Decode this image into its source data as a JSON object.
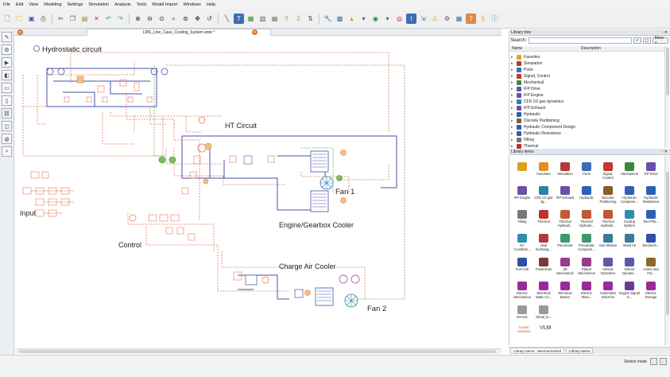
{
  "menu": [
    "File",
    "Edit",
    "View",
    "Modeling",
    "Settings",
    "Simulation",
    "Analysis",
    "Tools",
    "Model Import",
    "Windows",
    "Help"
  ],
  "document_tab": "LMS_Line_Case_Cooling_System.ame *",
  "canvas_labels": {
    "hydrostatic": "Hydrostatic circuit",
    "ht_circuit": "HT Circuit",
    "fan1": "Fan 1",
    "engine_cooler": "Engine/Gearbox Cooler",
    "input": "Input",
    "control": "Control",
    "charge_air": "Charge Air Cooler",
    "fan2": "Fan 2"
  },
  "library_tree": {
    "title": "Library tree",
    "search_label": "Search:",
    "search_value": "",
    "more_button": "More >",
    "col_name": "Name",
    "col_description": "Description",
    "items": [
      "Favorites",
      "Simulation",
      "Ports",
      "Signal, Control",
      "Mechanical",
      "IFP Drive",
      "IFP Engine",
      "CFD 1D gas dynamics",
      "IFP Exhaust",
      "Hydraulic",
      "Discrete Partitioning",
      "Hydraulic Component Design",
      "Hydraulic Resistance",
      "Filling",
      "Thermal"
    ],
    "item_colors": [
      "#e6a21c",
      "#b23b3b",
      "#3b6fb2",
      "#c0392b",
      "#3a8a3a",
      "#6b4fa8",
      "#6b4fa8",
      "#2f7fa8",
      "#6b4fa8",
      "#2f5fb2",
      "#8a5a2b",
      "#2f5fb2",
      "#2f5fb2",
      "#777777",
      "#c03030"
    ]
  },
  "library_items": {
    "title": "Library items",
    "items": [
      {
        "label": "..",
        "color": "#d9a21c"
      },
      {
        "label": "Favorites",
        "color": "#e09020"
      },
      {
        "label": "Simulation",
        "color": "#b23b3b"
      },
      {
        "label": "Ports",
        "color": "#3b6fb2"
      },
      {
        "label": "Signal, Control",
        "color": "#c0392b"
      },
      {
        "label": "Mechanical",
        "color": "#3a8a3a"
      },
      {
        "label": "IFP Drive",
        "color": "#6b4fa8"
      },
      {
        "label": "IFP Engine",
        "color": "#6b4fa8"
      },
      {
        "label": "CFD 1D gas dy...",
        "color": "#2f7fa8"
      },
      {
        "label": "IFP Exhaust",
        "color": "#6b4fa8"
      },
      {
        "label": "Hydraulic",
        "color": "#2f5fb2"
      },
      {
        "label": "Discrete Partitioning",
        "color": "#8a5a2b"
      },
      {
        "label": "Hydraulic Compone...",
        "color": "#2f5fb2"
      },
      {
        "label": "Hydraulic Resistance",
        "color": "#2f5fb2"
      },
      {
        "label": "Filling",
        "color": "#777777"
      },
      {
        "label": "Thermal",
        "color": "#c03030"
      },
      {
        "label": "Thermal Hydrauli...",
        "color": "#c05a30"
      },
      {
        "label": "Thermal Hydrauli...",
        "color": "#c05a30"
      },
      {
        "label": "Thermal Hydrauli...",
        "color": "#c05a30"
      },
      {
        "label": "Cooling System",
        "color": "#2f8fa8"
      },
      {
        "label": "Two-Pha...",
        "color": "#2f5fb2"
      },
      {
        "label": "Air-Condition...",
        "color": "#2f8fa8"
      },
      {
        "label": "Heat Exchang...",
        "color": "#b03a3a"
      },
      {
        "label": "Pneumatic",
        "color": "#3a9a6a"
      },
      {
        "label": "Pneumatic Compone...",
        "color": "#3a9a6a"
      },
      {
        "label": "Gas Mixture",
        "color": "#3a7a9a"
      },
      {
        "label": "Moist Air",
        "color": "#3a7a9a"
      },
      {
        "label": "Electroch...",
        "color": "#2f4fa8"
      },
      {
        "label": "Fuel Cell",
        "color": "#2f4fa8"
      },
      {
        "label": "Powertrain",
        "color": "#7a3a3a"
      },
      {
        "label": "3D Mechanical",
        "color": "#9a3a8a"
      },
      {
        "label": "Planar Mechanical",
        "color": "#9a3a8a"
      },
      {
        "label": "Vehicle Dynamics",
        "color": "#5a5aa8"
      },
      {
        "label": "Vehicle Dynami...",
        "color": "#5a5aa8"
      },
      {
        "label": "Cams and Fol...",
        "color": "#8a6a2a"
      },
      {
        "label": "Electric Mechanical",
        "color": "#9a2a9a"
      },
      {
        "label": "Electrical Static Co...",
        "color": "#9a2a9a"
      },
      {
        "label": "Electrical Basics",
        "color": "#9a2a9a"
      },
      {
        "label": "Electric Moto...",
        "color": "#9a2a9a"
      },
      {
        "label": "Automotive Electrics",
        "color": "#9a2a9a"
      },
      {
        "label": "Engine Signal G...",
        "color": "#6a3a9a"
      },
      {
        "label": "Electric Storage",
        "color": "#9a2a9a"
      },
      {
        "label": "Generic",
        "color": "#999999"
      },
      {
        "label": "virtual_le...",
        "color": "#999999"
      }
    ],
    "cosim_text": "Cosim Amesim",
    "vlm_text": "VLM"
  },
  "bottom_tabs": [
    "Library items - Mechanical/All",
    "Library items"
  ],
  "status": {
    "mode": "Sketch mode"
  },
  "colors": {
    "blue_line": "#4a4fa8",
    "red_dashed": "#e07a55",
    "green_dashed": "#66b04e",
    "accent_orange": "#e07020"
  }
}
